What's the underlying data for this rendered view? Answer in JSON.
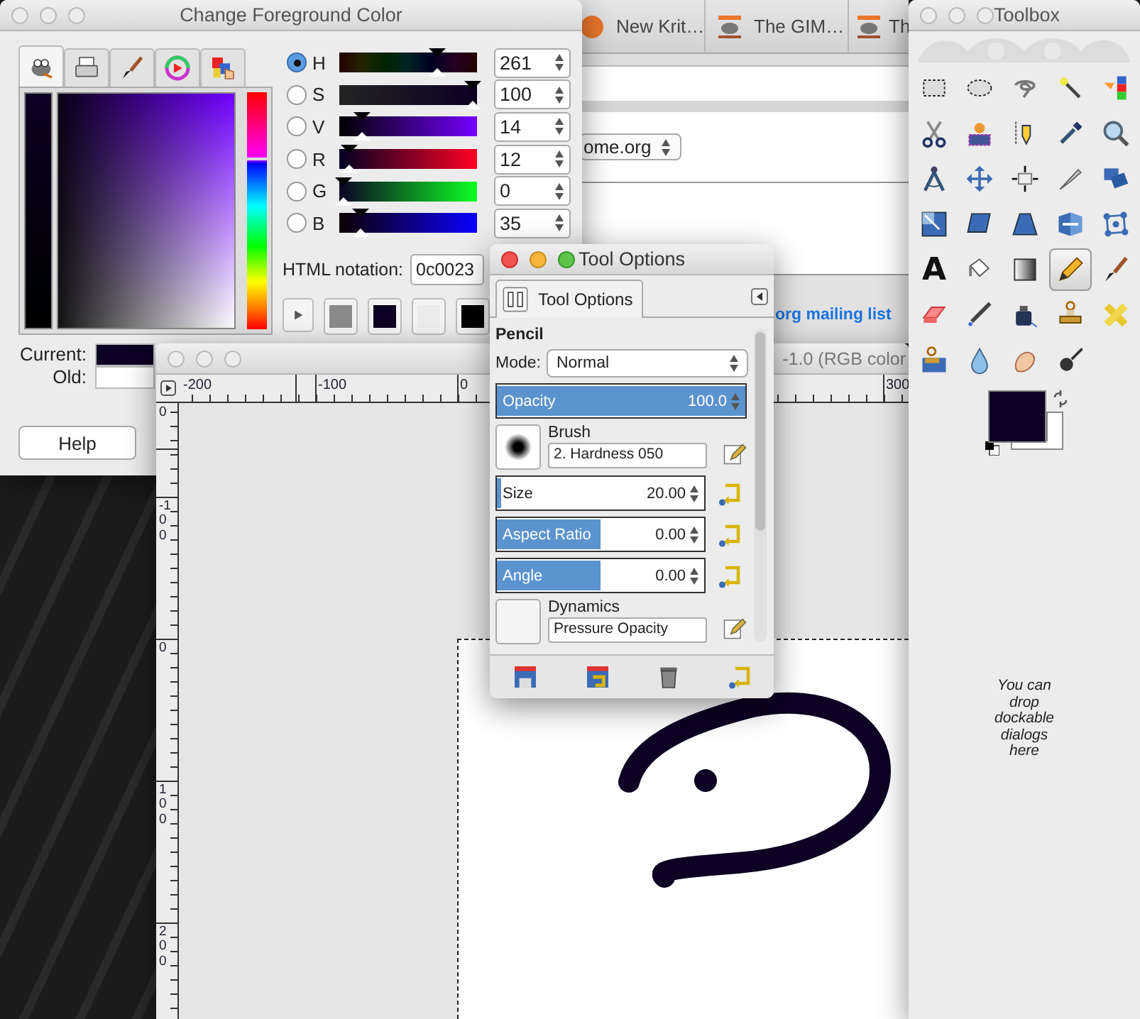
{
  "browser": {
    "tabs": [
      {
        "label": "New Krit…"
      },
      {
        "label": "The GIM…"
      },
      {
        "label": "Th"
      }
    ],
    "dropdown": "ome.org",
    "link": "org mailing list"
  },
  "color_dialog": {
    "title": "Change Foreground Color",
    "selector_tabs": [
      {
        "selected": true
      },
      {
        "selected": false
      },
      {
        "selected": false
      },
      {
        "selected": false
      },
      {
        "selected": false
      }
    ],
    "channels": [
      {
        "label": "H",
        "selected": true,
        "level": 0.725,
        "value": "261"
      },
      {
        "label": "S",
        "selected": false,
        "level": 1,
        "value": "100"
      },
      {
        "label": "V",
        "selected": false,
        "level": 0.14,
        "value": "14"
      },
      {
        "label": "R",
        "selected": false,
        "level": 0.047,
        "value": "12"
      },
      {
        "label": "G",
        "selected": false,
        "level": 0,
        "value": "0"
      },
      {
        "label": "B",
        "selected": false,
        "level": 0.137,
        "value": "35"
      }
    ],
    "html_label": "HTML notation:",
    "html_value": "0c0023",
    "history": [
      {
        "color": "#8a8a8a"
      },
      {
        "color": "#0c0023"
      },
      {
        "color": "#ececec"
      },
      {
        "color": "#000000"
      }
    ],
    "current_label": "Current:",
    "old_label": "Old:",
    "help": "Help"
  },
  "image_window": {
    "title": "-1.0 (RGB color",
    "hruler": [
      "-200",
      "-100",
      "0",
      "300"
    ],
    "vruler": [
      "0",
      "-100",
      "0",
      "100",
      "200"
    ]
  },
  "tool_options": {
    "title": "Tool Options",
    "tab": "Tool Options",
    "tool": "Pencil",
    "mode_label": "Mode:",
    "mode": "Normal",
    "sliders": [
      {
        "kind": "plain",
        "label": "Opacity",
        "value": "100.0",
        "level": 1
      },
      {
        "kind": "reset",
        "label": "Size",
        "value": "20.00",
        "level": 0.02
      },
      {
        "kind": "reset",
        "label": "Aspect Ratio",
        "value": "0.00",
        "level": 0.5
      },
      {
        "kind": "reset",
        "label": "Angle",
        "value": "0.00",
        "level": 0.5
      }
    ],
    "brush_label": "Brush",
    "brush": "2. Hardness 050",
    "dynamics_label": "Dynamics",
    "dynamics": "Pressure Opacity"
  },
  "toolbox": {
    "title": "Toolbox",
    "tools": [
      {
        "selected": false
      },
      {
        "selected": false
      },
      {
        "selected": false
      },
      {
        "selected": false
      },
      {
        "selected": false
      },
      {
        "selected": false
      },
      {
        "selected": false
      },
      {
        "selected": false
      },
      {
        "selected": false
      },
      {
        "selected": false
      },
      {
        "selected": false
      },
      {
        "selected": false
      },
      {
        "selected": false
      },
      {
        "selected": false
      },
      {
        "selected": false
      },
      {
        "selected": false
      },
      {
        "selected": false
      },
      {
        "selected": false
      },
      {
        "selected": false
      },
      {
        "selected": false
      },
      {
        "glyph": "A",
        "selected": false
      },
      {
        "selected": false
      },
      {
        "selected": false
      },
      {
        "selected": true
      },
      {
        "selected": false
      },
      {
        "selected": false
      },
      {
        "selected": false
      },
      {
        "selected": false
      },
      {
        "selected": false
      },
      {
        "selected": false
      },
      {
        "selected": false
      },
      {
        "selected": false
      },
      {
        "selected": false
      },
      {
        "selected": false
      }
    ],
    "hint": "You can drop dockable dialogs here"
  }
}
